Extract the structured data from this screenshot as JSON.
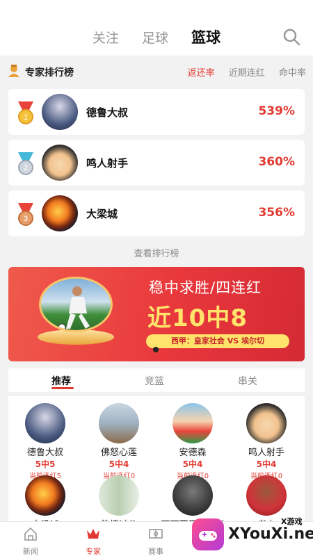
{
  "top_tabs": [
    {
      "label": "关注",
      "active": false
    },
    {
      "label": "足球",
      "active": false
    },
    {
      "label": "篮球",
      "active": true
    }
  ],
  "ranking": {
    "title": "专家排行榜",
    "sort_options": [
      {
        "label": "返还率",
        "active": true
      },
      {
        "label": "近期连红",
        "active": false
      },
      {
        "label": "命中率",
        "active": false
      }
    ],
    "entries": [
      {
        "rank": "1",
        "name": "德鲁大叔",
        "rate": "539%"
      },
      {
        "rank": "2",
        "name": "鸣人射手",
        "rate": "360%"
      },
      {
        "rank": "3",
        "name": "大梁城",
        "rate": "356%"
      }
    ],
    "view_all": "查看排行榜"
  },
  "banner": {
    "line1": "稳中求胜/四连红",
    "line2": "近10中8",
    "match": "西甲：皇家社会 VS 埃尔切"
  },
  "sub_tabs": [
    {
      "label": "推荐",
      "active": true
    },
    {
      "label": "竞篮",
      "active": false
    },
    {
      "label": "串关",
      "active": false
    }
  ],
  "experts": [
    {
      "name": "德鲁大叔",
      "record": "5中5",
      "streak": "当前连红5"
    },
    {
      "name": "佛怒心莲",
      "record": "5中4",
      "streak": "当前连红0"
    },
    {
      "name": "安德森",
      "record": "5中4",
      "streak": "当前连红0"
    },
    {
      "name": "鸣人射手",
      "record": "5中4",
      "streak": "当前连红0"
    },
    {
      "name": "大梁城",
      "record": "",
      "streak": ""
    },
    {
      "name": "热情过分",
      "record": "",
      "streak": ""
    },
    {
      "name": "可可西里的王者",
      "record": "",
      "streak": ""
    },
    {
      "name": "老木",
      "record": "",
      "streak": ""
    }
  ],
  "bottom_nav": [
    {
      "label": "新闻",
      "icon": "house-icon",
      "active": false
    },
    {
      "label": "专家",
      "icon": "crown-icon",
      "active": true
    },
    {
      "label": "赛事",
      "icon": "court-icon",
      "active": false
    }
  ],
  "watermark": {
    "brand": "XYouXi.net",
    "small": "X游戏"
  },
  "colors": {
    "accent": "#e23a32",
    "banner_yellow": "#ffe36b"
  }
}
